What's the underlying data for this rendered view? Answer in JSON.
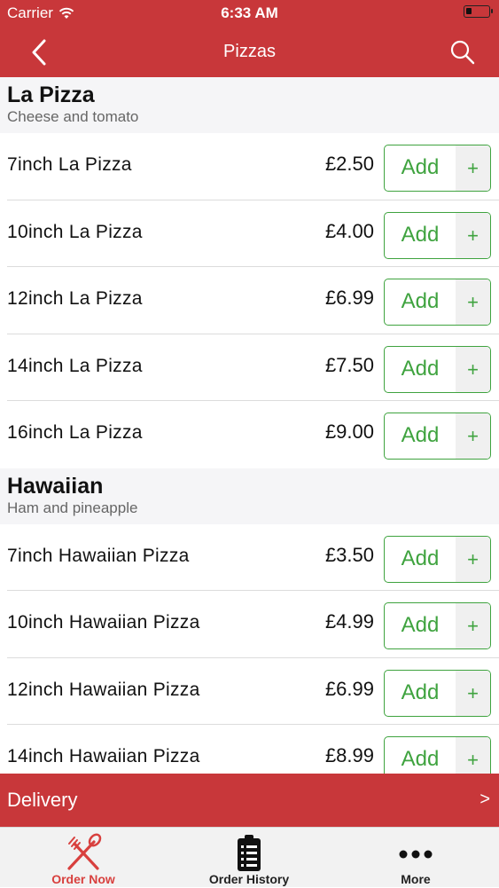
{
  "status": {
    "carrier": "Carrier",
    "time": "6:33 AM",
    "battery_level": 0.25
  },
  "nav": {
    "title": "Pizzas",
    "back_icon": "chevron-left-icon",
    "search_icon": "search-icon"
  },
  "sections": [
    {
      "title": "La Pizza",
      "subtitle": "Cheese and tomato",
      "items": [
        {
          "name": "7inch La Pizza",
          "price": "£2.50",
          "add_label": "Add",
          "plus": "+"
        },
        {
          "name": "10inch La Pizza",
          "price": "£4.00",
          "add_label": "Add",
          "plus": "+"
        },
        {
          "name": "12inch La Pizza",
          "price": "£6.99",
          "add_label": "Add",
          "plus": "+"
        },
        {
          "name": "14inch La Pizza",
          "price": "£7.50",
          "add_label": "Add",
          "plus": "+"
        },
        {
          "name": "16inch La Pizza",
          "price": "£9.00",
          "add_label": "Add",
          "plus": "+"
        }
      ]
    },
    {
      "title": "Hawaiian",
      "subtitle": "Ham and pineapple",
      "items": [
        {
          "name": "7inch Hawaiian Pizza",
          "price": "£3.50",
          "add_label": "Add",
          "plus": "+"
        },
        {
          "name": "10inch Hawaiian Pizza",
          "price": "£4.99",
          "add_label": "Add",
          "plus": "+"
        },
        {
          "name": "12inch Hawaiian Pizza",
          "price": "£6.99",
          "add_label": "Add",
          "plus": "+"
        },
        {
          "name": "14inch Hawaiian Pizza",
          "price": "£8.99",
          "add_label": "Add",
          "plus": "+"
        }
      ]
    }
  ],
  "delivery": {
    "label": "Delivery",
    "arrow": ">"
  },
  "tabs": [
    {
      "label": "Order Now",
      "icon": "fork-spoon-icon",
      "active": true
    },
    {
      "label": "Order History",
      "icon": "clipboard-list-icon",
      "active": false
    },
    {
      "label": "More",
      "icon": "more-dots-icon",
      "active": false
    }
  ],
  "colors": {
    "brand": "#c8373a",
    "add_green": "#3fa33f",
    "active_tab": "#d8403e"
  }
}
